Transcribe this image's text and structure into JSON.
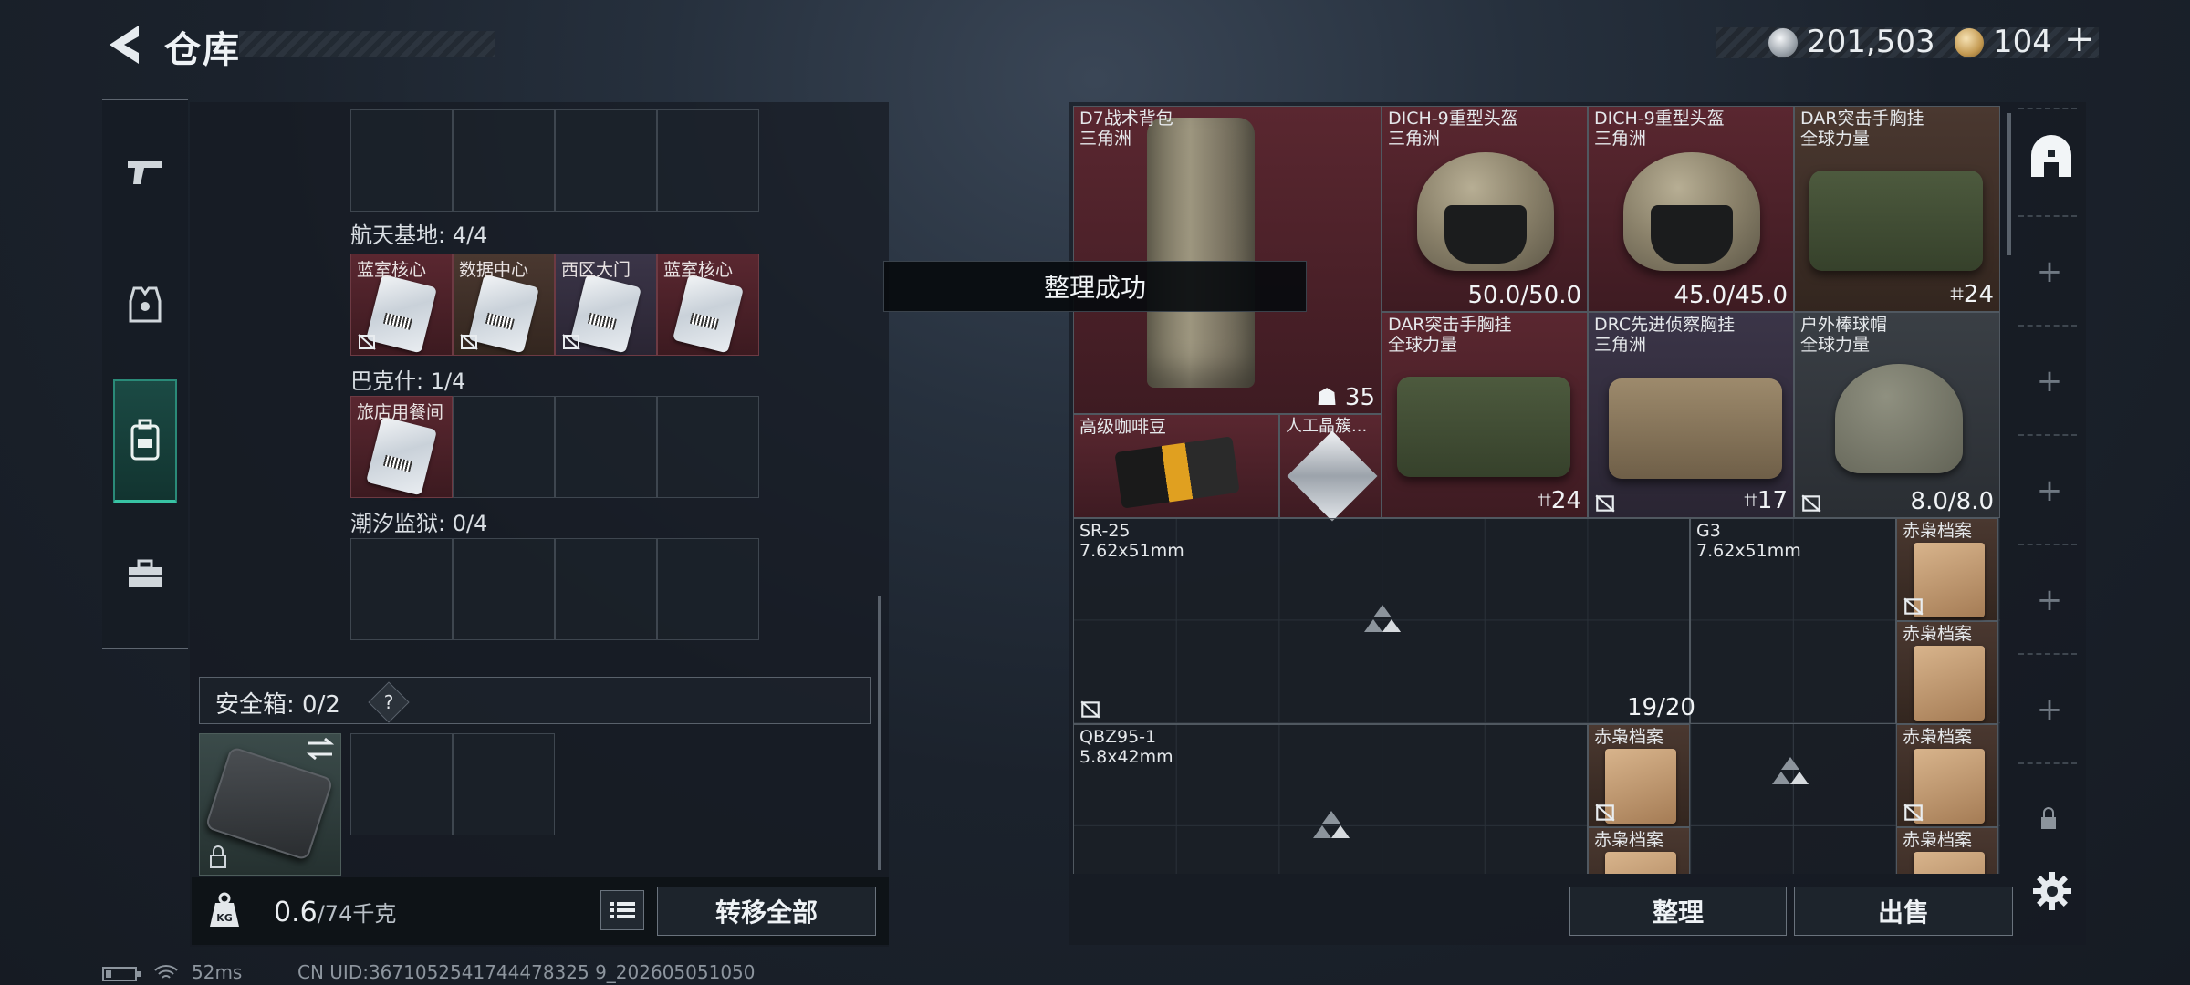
{
  "header": {
    "title": "仓库",
    "silver_value": "201,503",
    "gold_value": "104",
    "plus_label": "+"
  },
  "left": {
    "sections": [
      {
        "name": "航天基地: 4/4",
        "slots": [
          {
            "label": "蓝室核心",
            "color": "red"
          },
          {
            "label": "数据中心",
            "color": "brown"
          },
          {
            "label": "西区大门",
            "color": "purple"
          },
          {
            "label": "蓝室核心",
            "color": "red"
          }
        ]
      },
      {
        "name": "巴克什: 1/4",
        "slots": [
          {
            "label": "旅店用餐间",
            "color": "red"
          },
          {
            "label": "",
            "color": ""
          },
          {
            "label": "",
            "color": ""
          },
          {
            "label": "",
            "color": ""
          }
        ]
      },
      {
        "name": "潮汐监狱: 0/4",
        "slots": [
          {
            "label": "",
            "color": ""
          },
          {
            "label": "",
            "color": ""
          },
          {
            "label": "",
            "color": ""
          },
          {
            "label": "",
            "color": ""
          }
        ]
      }
    ],
    "safe_box_label": "安全箱: 0/2",
    "safe_help": "?",
    "weight": "0.6",
    "weight_max": "/74千克",
    "transfer_all": "转移全部"
  },
  "toast": "整理成功",
  "right": {
    "items": [
      {
        "name": "D7战术背包\n三角洲",
        "value": "35",
        "bg": "red"
      },
      {
        "name": "DICH-9重型头盔\n三角洲",
        "value": "50.0/50.0",
        "bg": "red"
      },
      {
        "name": "DICH-9重型头盔\n三角洲",
        "value": "45.0/45.0",
        "bg": "red"
      },
      {
        "name": "DAR突击手胸挂\n全球力量",
        "value": "24",
        "bg": "brown"
      },
      {
        "name": "DAR突击手胸挂\n全球力量",
        "value": "24",
        "bg": "red"
      },
      {
        "name": "DRC先进侦察胸挂\n三角洲",
        "value": "17",
        "bg": "purple"
      },
      {
        "name": "户外棒球帽\n全球力量",
        "value": "8.0/8.0",
        "bg": "gray"
      },
      {
        "name": "高级咖啡豆",
        "value": "",
        "bg": "red"
      },
      {
        "name": "人工晶簇...",
        "value": "",
        "bg": "red"
      },
      {
        "name": "SR-25\n7.62x51mm",
        "value": "",
        "bg": "dark"
      },
      {
        "name": "G3\n7.62x51mm",
        "value": "19/20",
        "bg": "dark"
      },
      {
        "name": "QBZ95-1\n5.8x42mm",
        "value": "",
        "bg": "dark"
      },
      {
        "name": "赤枭档案",
        "value": "",
        "bg": "brown"
      }
    ],
    "sort": "整理",
    "sell": "出售"
  },
  "status": {
    "ping": "52ms",
    "uid": "CN UID:3671052541744478325 9_202605051050"
  }
}
